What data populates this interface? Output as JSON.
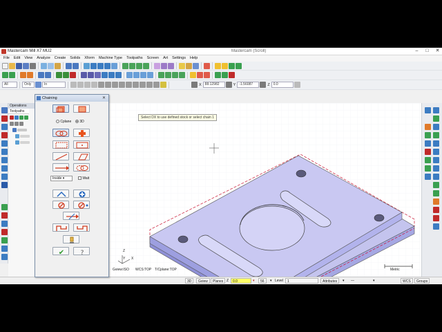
{
  "app": {
    "title": "Mastercam Mill X7 MU2",
    "document": "Mastercam (Scroll)"
  },
  "window_controls": {
    "minimize": "–",
    "maximize": "□",
    "close": "✕"
  },
  "menu": [
    "File",
    "Edit",
    "View",
    "Analyze",
    "Create",
    "Solids",
    "Xform",
    "Machine Type",
    "Toolpaths",
    "Screen",
    "Art",
    "Settings",
    "Help"
  ],
  "toolbar3": {
    "attr_field": "All",
    "only_field": "Only",
    "mode_field": "In",
    "x_value": "88.12982",
    "y_value": "-1.56087",
    "z_value": "0.0"
  },
  "ops_panel": {
    "header": "Operations",
    "tab_label": "Toolpaths"
  },
  "viewport": {
    "prompt": "Select DX to use defined stock or select chain 1",
    "gview_label": "Gview:ISO",
    "wcs_label": "WCS:TOP",
    "cplane_label": "T/Cplane:TOP",
    "scale_label": "Metric",
    "axis_x": "X",
    "axis_y": "Y",
    "axis_z": "Z"
  },
  "dialog": {
    "title": "Chaining",
    "close_glyph": "✕",
    "cplane_label": "Cplane",
    "view3d_label": "3D",
    "inside_select": "Inside",
    "wait_label": "Wait",
    "ok_glyph": "✔",
    "help_glyph": "?"
  },
  "statusbar": {
    "mode_3d": "3D",
    "gview": "Gview",
    "planes": "Planes",
    "z_label": "Z",
    "z_value": "0.0",
    "color_number": "56",
    "level_label": "Level",
    "level_value": "1",
    "attributes": "Attributes",
    "wcs": "WCS",
    "groups": "Groups"
  },
  "colors": {
    "part_top": "#c9c8f2",
    "part_side": "#9d9fe0",
    "stock_outline": "#c8102e",
    "accent_orange": "#e8541e"
  }
}
